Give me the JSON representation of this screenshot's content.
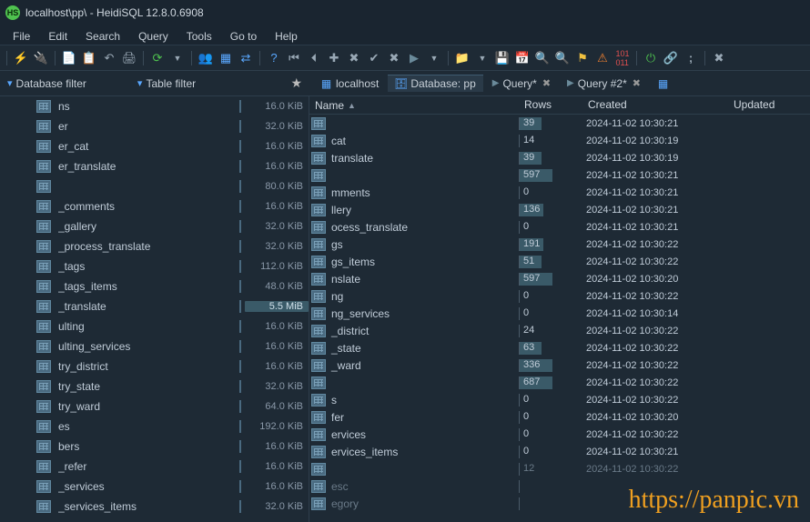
{
  "title": "localhost\\pp\\ - HeidiSQL 12.8.0.6908",
  "menu": [
    "File",
    "Edit",
    "Search",
    "Query",
    "Tools",
    "Go to",
    "Help"
  ],
  "filters": {
    "db": "Database filter",
    "table": "Table filter"
  },
  "tabs": {
    "host": "localhost",
    "db": "Database: pp",
    "q1": "Query*",
    "q2": "Query #2*"
  },
  "columns": {
    "name": "Name",
    "rows": "Rows",
    "created": "Created",
    "updated": "Updated"
  },
  "sidebar": [
    {
      "name": "ns",
      "size": "16.0 KiB"
    },
    {
      "name": "er",
      "size": "32.0 KiB"
    },
    {
      "name": "er_cat",
      "size": "16.0 KiB"
    },
    {
      "name": "er_translate",
      "size": "16.0 KiB"
    },
    {
      "name": "",
      "size": "80.0 KiB"
    },
    {
      "name": "_comments",
      "size": "16.0 KiB"
    },
    {
      "name": "_gallery",
      "size": "32.0 KiB"
    },
    {
      "name": "_process_translate",
      "size": "32.0 KiB"
    },
    {
      "name": "_tags",
      "size": "112.0 KiB"
    },
    {
      "name": "_tags_items",
      "size": "48.0 KiB"
    },
    {
      "name": "_translate",
      "size": "5.5 MiB",
      "hl": true
    },
    {
      "name": "ulting",
      "size": "16.0 KiB"
    },
    {
      "name": "ulting_services",
      "size": "16.0 KiB"
    },
    {
      "name": "try_district",
      "size": "16.0 KiB"
    },
    {
      "name": "try_state",
      "size": "32.0 KiB"
    },
    {
      "name": "try_ward",
      "size": "64.0 KiB"
    },
    {
      "name": "es",
      "size": "192.0 KiB"
    },
    {
      "name": "bers",
      "size": "16.0 KiB"
    },
    {
      "name": "_refer",
      "size": "16.0 KiB"
    },
    {
      "name": "_services",
      "size": "16.0 KiB"
    },
    {
      "name": "_services_items",
      "size": "32.0 KiB"
    }
  ],
  "grid": [
    {
      "name": "",
      "rows": "39",
      "bar": true,
      "created": "2024-11-02 10:30:21"
    },
    {
      "name": "cat",
      "rows": "14",
      "created": "2024-11-02 10:30:19"
    },
    {
      "name": "translate",
      "rows": "39",
      "bar": true,
      "created": "2024-11-02 10:30:19"
    },
    {
      "name": "",
      "rows": "597",
      "bar": true,
      "wide": true,
      "created": "2024-11-02 10:30:21"
    },
    {
      "name": "mments",
      "rows": "0",
      "created": "2024-11-02 10:30:21"
    },
    {
      "name": "llery",
      "rows": "136",
      "bar": true,
      "created": "2024-11-02 10:30:21"
    },
    {
      "name": "ocess_translate",
      "rows": "0",
      "created": "2024-11-02 10:30:21"
    },
    {
      "name": "gs",
      "rows": "191",
      "bar": true,
      "created": "2024-11-02 10:30:22"
    },
    {
      "name": "gs_items",
      "rows": "51",
      "bar": true,
      "created": "2024-11-02 10:30:22"
    },
    {
      "name": "nslate",
      "rows": "597",
      "bar": true,
      "wide": true,
      "created": "2024-11-02 10:30:20"
    },
    {
      "name": "ng",
      "rows": "0",
      "created": "2024-11-02 10:30:22"
    },
    {
      "name": "ng_services",
      "rows": "0",
      "created": "2024-11-02 10:30:14"
    },
    {
      "name": "_district",
      "rows": "24",
      "created": "2024-11-02 10:30:22"
    },
    {
      "name": "_state",
      "rows": "63",
      "bar": true,
      "created": "2024-11-02 10:30:22"
    },
    {
      "name": "_ward",
      "rows": "336",
      "bar": true,
      "wide": true,
      "created": "2024-11-02 10:30:22"
    },
    {
      "name": "",
      "rows": "687",
      "bar": true,
      "wide": true,
      "created": "2024-11-02 10:30:22"
    },
    {
      "name": "s",
      "rows": "0",
      "created": "2024-11-02 10:30:22"
    },
    {
      "name": "fer",
      "rows": "0",
      "created": "2024-11-02 10:30:20"
    },
    {
      "name": "ervices",
      "rows": "0",
      "created": "2024-11-02 10:30:22"
    },
    {
      "name": "ervices_items",
      "rows": "0",
      "created": "2024-11-02 10:30:21"
    },
    {
      "name": "",
      "rows": "12",
      "created": "2024-11-02 10:30:22",
      "dim": true
    },
    {
      "name": "esc",
      "rows": "",
      "created": "",
      "dim": true
    },
    {
      "name": "egory",
      "rows": "",
      "created": "",
      "dim": true
    }
  ],
  "watermark": "https://panpic.vn"
}
